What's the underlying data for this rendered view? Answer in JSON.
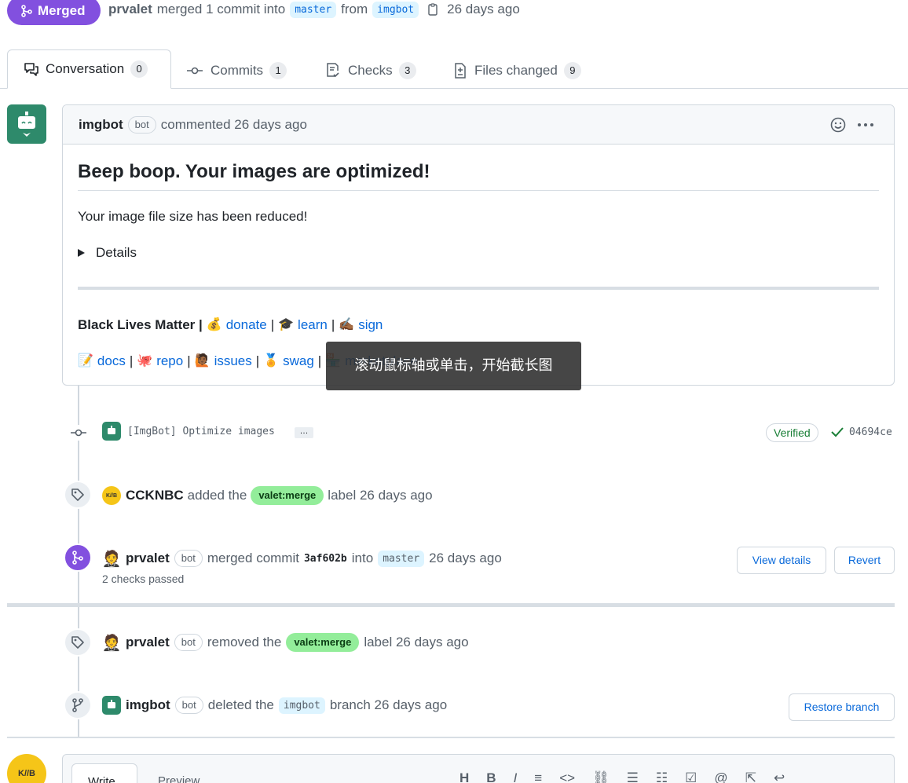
{
  "header": {
    "state_label": "Merged",
    "author": "prvalet",
    "merged_text": "merged 1 commit into",
    "base_branch": "master",
    "from_text": "from",
    "head_branch": "imgbot",
    "time": "26 days ago"
  },
  "tabs": [
    {
      "label": "Conversation",
      "count": "0"
    },
    {
      "label": "Commits",
      "count": "1"
    },
    {
      "label": "Checks",
      "count": "3"
    },
    {
      "label": "Files changed",
      "count": "9"
    }
  ],
  "comment": {
    "author": "imgbot",
    "badge": "bot",
    "meta": "commented 26 days ago",
    "heading": "Beep boop. Your images are optimized!",
    "body": "Your image file size has been reduced!",
    "details": "Details",
    "blm_text": "Black Lives Matter |",
    "links1": [
      {
        "emoji": "💰",
        "label": "donate",
        "sep": "|"
      },
      {
        "emoji": "🎓",
        "label": "learn",
        "sep": "|"
      },
      {
        "emoji": "✍🏾",
        "label": "sign",
        "sep": ""
      }
    ],
    "links2": [
      {
        "emoji": "📝",
        "label": "docs",
        "sep": "|"
      },
      {
        "emoji": "🐙",
        "label": "repo",
        "sep": "|"
      },
      {
        "emoji": "🙋🏾",
        "label": "issues",
        "sep": "|"
      },
      {
        "emoji": "🏅",
        "label": "swag",
        "sep": "|"
      },
      {
        "emoji": "🏪",
        "label": "marketplace",
        "sep": ""
      }
    ]
  },
  "tooltip": "滚动鼠标轴或单击，开始截长图",
  "commit": {
    "message": "[ImgBot] Optimize images",
    "ellipsis": "…",
    "verified": "Verified",
    "sha": "04694ce"
  },
  "event_label_added": {
    "actor": "CCKNBC",
    "text1": "added the",
    "label": "valet:merge",
    "text2": "label 26 days ago"
  },
  "event_merged": {
    "actor": "prvalet",
    "badge": "bot",
    "text1": "merged commit",
    "sha": "3af602b",
    "text2": "into",
    "branch": "master",
    "time": "26 days ago",
    "checks": "2 checks passed",
    "view_details": "View details",
    "revert": "Revert"
  },
  "event_label_removed": {
    "actor": "prvalet",
    "badge": "bot",
    "text1": "removed the",
    "label": "valet:merge",
    "text2": "label 26 days ago"
  },
  "event_deleted": {
    "actor": "imgbot",
    "badge": "bot",
    "text1": "deleted the",
    "branch": "imgbot",
    "text2": "branch 26 days ago",
    "restore": "Restore branch"
  },
  "editor": {
    "write_tab": "Write",
    "preview_tab": "Preview"
  },
  "colors": {
    "merged": "#8250df",
    "link": "#0969da",
    "label": "#93ed9a",
    "bot_avatar": "#2e8a6b"
  }
}
